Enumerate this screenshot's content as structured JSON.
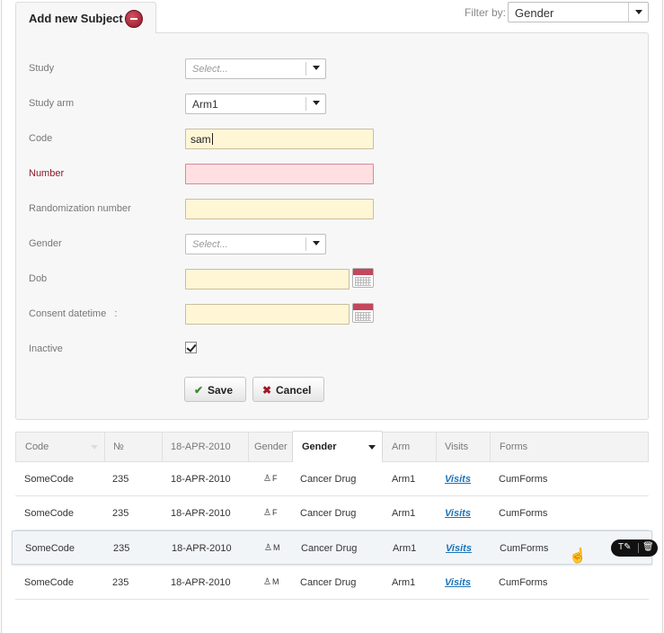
{
  "tab": {
    "label": "Add new Subject"
  },
  "filter": {
    "label": "Filter by:",
    "value": "Gender"
  },
  "form": {
    "study": {
      "label": "Study",
      "placeholder": "Select..."
    },
    "study_arm": {
      "label": "Study arm",
      "value": "Arm1"
    },
    "code": {
      "label": "Code",
      "value": "sam"
    },
    "number": {
      "label": "Number",
      "value": ""
    },
    "randomization_number": {
      "label": "Randomization number",
      "value": ""
    },
    "gender": {
      "label": "Gender",
      "placeholder": "Select..."
    },
    "dob": {
      "label": "Dob",
      "value": ""
    },
    "consent_datetime": {
      "label": "Consent datetime   :",
      "value": ""
    },
    "inactive": {
      "label": "Inactive",
      "checked": true
    },
    "save_label": "Save",
    "cancel_label": "Cancel"
  },
  "table": {
    "headers": [
      "Code",
      "№",
      "18-APR-2010",
      "Gender",
      "Gender",
      "Arm",
      "Visits",
      "Forms"
    ],
    "rows": [
      {
        "code": "SomeCode",
        "num": "235",
        "date": "18-APR-2010",
        "gender_icon": "F",
        "gender": "Cancer Drug",
        "arm": "Arm1",
        "visits": "Visits",
        "forms": "CumForms"
      },
      {
        "code": "SomeCode",
        "num": "235",
        "date": "18-APR-2010",
        "gender_icon": "F",
        "gender": "Cancer Drug",
        "arm": "Arm1",
        "visits": "Visits",
        "forms": "CumForms"
      },
      {
        "code": "SomeCode",
        "num": "235",
        "date": "18-APR-2010",
        "gender_icon": "M",
        "gender": "Cancer Drug",
        "arm": "Arm1",
        "visits": "Visits",
        "forms": "CumForms"
      },
      {
        "code": "SomeCode",
        "num": "235",
        "date": "18-APR-2010",
        "gender_icon": "M",
        "gender": "Cancer Drug",
        "arm": "Arm1",
        "visits": "Visits",
        "forms": "CumForms"
      }
    ]
  },
  "row_tools": {
    "edit_icon": "text-edit-icon",
    "delete_icon": "trash-icon",
    "edit_glyph": "T✎",
    "delete_glyph": "🗑"
  },
  "colors": {
    "input_bg": "#fff6d6",
    "error_bg": "#ffdfe2",
    "link": "#1e74b8",
    "remove": "#a0172a"
  }
}
